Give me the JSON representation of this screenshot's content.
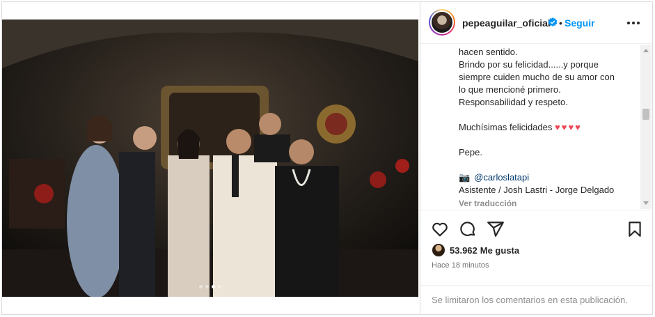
{
  "post": {
    "username": "pepeaguilar_oficial",
    "follow_label": "Seguir",
    "separator": "•",
    "carousel": {
      "count": 4,
      "active_index": 2
    },
    "photo_desc_icon": "wedding-group-photo"
  },
  "caption": {
    "line1": "hacen sentido.",
    "line2": "Brindo por su felicidad......y porque",
    "line3": "siempre cuiden mucho de su amor con",
    "line4": "lo que mencioné primero.",
    "line5": "Responsabilidad y respeto.",
    "line6": "Muchísimas felicidades",
    "hearts": "♥♥♥♥",
    "line7": "Pepe.",
    "camera_icon": "📷",
    "mention": "@carloslatapi",
    "credits": "Asistente / Josh Lastri - Jorge Delgado",
    "translate": "Ver traducción"
  },
  "engagement": {
    "likes_count": "53.962",
    "likes_label": "Me gusta",
    "time": "Hace 18 minutos"
  },
  "comments": {
    "disabled_text": "Se limitaron los comentarios en esta publicación."
  },
  "colors": {
    "accent": "#0095f6",
    "heart": "#ed4956",
    "text": "#262626",
    "muted": "#8e8e8e"
  }
}
